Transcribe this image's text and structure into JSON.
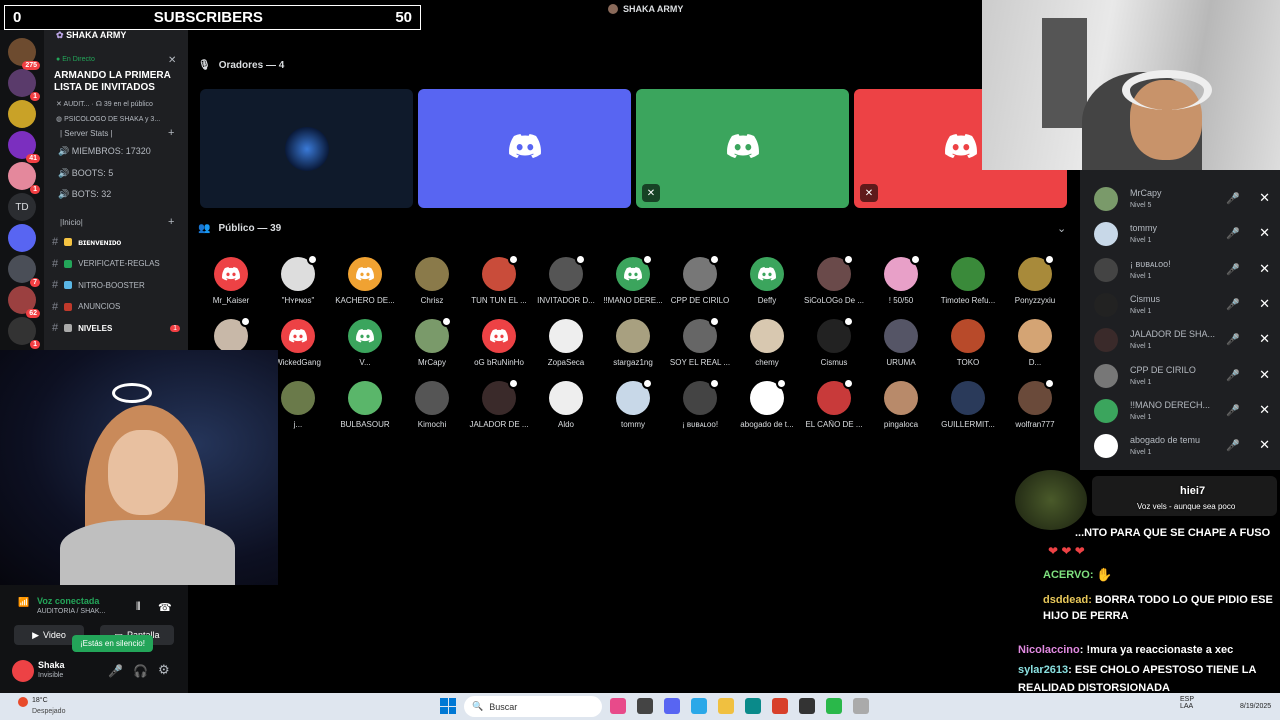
{
  "overlay": {
    "left": "0",
    "label": "SUBSCRIBERS",
    "right": "50"
  },
  "top_user": "SHAKA ARMY",
  "rail": [
    {
      "badge": "275",
      "color": "#6d4b2f"
    },
    {
      "badge": "1",
      "color": "#5a3b6b"
    },
    {
      "badge": "",
      "color": "#c9a227"
    },
    {
      "badge": "41",
      "color": "#7b2fbf"
    },
    {
      "badge": "1",
      "color": "#e4889c"
    },
    {
      "badge": "TD",
      "color": "#2b2d31"
    },
    {
      "badge": "",
      "color": "#5865f2"
    },
    {
      "badge": "7",
      "color": "#4a4e57"
    },
    {
      "badge": "62",
      "color": "#9b4040"
    },
    {
      "badge": "1",
      "color": "#333"
    }
  ],
  "sidebar": {
    "server_name": "SHAKA ARMY",
    "live": "En Directo",
    "event_title": "ARMANDO LA PRIMERA LISTA DE INVITADOS",
    "audit": "AUDIT...",
    "public_count": "39 en el público",
    "psico": "PSICOLOGO DE SHAKA y 3...",
    "stats_header": "| Server Stats |",
    "stats": [
      "MIEMBROS: 17320",
      "BOOTS: 5",
      "BOTS: 32"
    ],
    "inicio_header": "|Inicio|",
    "channels": [
      {
        "label": "ʙɪᴇɴᴠᴇɴɪᴅᴏ",
        "emo": "#f5c342",
        "bold": true
      },
      {
        "label": "VERIFICATE-REGLAS",
        "emo": "#23a559",
        "bold": false
      },
      {
        "label": "NITRO-BOOSTER",
        "emo": "#5ab6e6",
        "bold": false
      },
      {
        "label": "ANUNCIOS",
        "emo": "#c0392b",
        "bold": false
      },
      {
        "label": "NIVELES",
        "emo": "#aaa",
        "bold": true
      }
    ],
    "niveles_badge": "1"
  },
  "user_panel": {
    "voice": "Voz conectada",
    "voice_sub": "AUDITORIA / SHAK...",
    "video": "Video",
    "screen": "Pantalla",
    "tooltip": "¡Estás en silencio!",
    "name": "Shaka",
    "status": "Invisible"
  },
  "stage": {
    "speakers_title": "Oradores — 4",
    "public_title": "Público — 39",
    "speaker_tiles": [
      {
        "color": "#0f1a2b",
        "icon": "avatar"
      },
      {
        "color": "#5865f2",
        "icon": "discord"
      },
      {
        "color": "#3ba55d",
        "icon": "discord"
      },
      {
        "color": "#ed4245",
        "icon": "discord"
      }
    ],
    "audience": [
      [
        {
          "name": "Mr_Kaiser",
          "color": "#ed4245",
          "discord": true,
          "dot": false
        },
        {
          "name": "\"Hʏᴘɴᴏs\"",
          "color": "#ddd",
          "discord": false,
          "dot": true
        },
        {
          "name": "KACHERO DE...",
          "color": "#f0a232",
          "discord": true,
          "dot": false
        },
        {
          "name": "Chrisz",
          "color": "#8a7a4a",
          "discord": false,
          "dot": false
        },
        {
          "name": "TUN TUN EL ...",
          "color": "#c94c3a",
          "discord": false,
          "dot": true
        },
        {
          "name": "INVITADOR D...",
          "color": "#555",
          "discord": false,
          "dot": true
        },
        {
          "name": "!!MANO DERE...",
          "color": "#3ba55d",
          "discord": true,
          "dot": true
        },
        {
          "name": "CPP DE CIRILO",
          "color": "#777",
          "discord": false,
          "dot": true
        },
        {
          "name": "Deffy",
          "color": "#3ba55d",
          "discord": true,
          "dot": false
        },
        {
          "name": "SiCoLOGo De ...",
          "color": "#6a4a4a",
          "discord": false,
          "dot": true
        },
        {
          "name": "! 50/50",
          "color": "#e8a0c8",
          "discord": false,
          "dot": true
        },
        {
          "name": "Timoteo Refu...",
          "color": "#3a8a3a",
          "discord": false,
          "dot": false
        },
        {
          "name": "Ponyzzyxiu",
          "color": "#a88a3a",
          "discord": false,
          "dot": true
        }
      ],
      [
        {
          "name": "",
          "color": "#c8b8a8",
          "discord": false,
          "dot": true
        },
        {
          "name": "WickedGang",
          "color": "#ed4245",
          "discord": true,
          "dot": false
        },
        {
          "name": "V...",
          "color": "#3ba55d",
          "discord": true,
          "dot": false
        },
        {
          "name": "MrCapy",
          "color": "#7a9a6a",
          "discord": false,
          "dot": true
        },
        {
          "name": "oG bRuNinHo",
          "color": "#ed4245",
          "discord": true,
          "dot": false
        },
        {
          "name": "ZopaSeca",
          "color": "#eee",
          "discord": false,
          "dot": false
        },
        {
          "name": "stargaz1ng",
          "color": "#a8a080",
          "discord": false,
          "dot": false
        },
        {
          "name": "SOY EL REAL ...",
          "color": "#666",
          "discord": false,
          "dot": true
        },
        {
          "name": "chemy",
          "color": "#d8c8b0",
          "discord": false,
          "dot": false
        },
        {
          "name": "Cismus",
          "color": "#222",
          "discord": false,
          "dot": true
        },
        {
          "name": "URUMA",
          "color": "#556",
          "discord": false,
          "dot": false
        },
        {
          "name": "TOKO",
          "color": "#b84a2a",
          "discord": false,
          "dot": false
        },
        {
          "name": "D...",
          "color": "#d4a474",
          "discord": false,
          "dot": false
        }
      ],
      [
        {
          "name": "j...",
          "color": "#6a7a4a",
          "discord": false,
          "dot": false
        },
        {
          "name": "BULBASOUR",
          "color": "#5ab66a",
          "discord": false,
          "dot": false
        },
        {
          "name": "Kimochi",
          "color": "#555",
          "discord": false,
          "dot": false
        },
        {
          "name": "JALADOR DE ...",
          "color": "#3a2a2a",
          "discord": false,
          "dot": true
        },
        {
          "name": "Aldo",
          "color": "#eee",
          "discord": false,
          "dot": false
        },
        {
          "name": "tommy",
          "color": "#c8d8e8",
          "discord": false,
          "dot": true
        },
        {
          "name": "¡ ʙᴜʙᴀʟᴏᴏ!",
          "color": "#444",
          "discord": false,
          "dot": true
        },
        {
          "name": "abogado de t...",
          "color": "#fff",
          "discord": false,
          "dot": true
        },
        {
          "name": "EL CAÑO DE ...",
          "color": "#c83a3a",
          "discord": false,
          "dot": true
        },
        {
          "name": "pingaloca",
          "color": "#b88a6a",
          "discord": false,
          "dot": false
        },
        {
          "name": "GUILLERMIT...",
          "color": "#2a3a5a",
          "discord": false,
          "dot": false
        },
        {
          "name": "wolfran777",
          "color": "#6a4a3a",
          "discord": false,
          "dot": true
        }
      ]
    ]
  },
  "right_list": [
    {
      "name": "MrCapy",
      "level": "Nivel 5",
      "color": "#7a9a6a"
    },
    {
      "name": "tommy",
      "level": "Nivel 1",
      "color": "#c8d8e8"
    },
    {
      "name": "¡ ʙᴜʙᴀʟᴏᴏ!",
      "level": "Nivel 1",
      "color": "#444"
    },
    {
      "name": "Cismus",
      "level": "Nivel 1",
      "color": "#222"
    },
    {
      "name": "JALADOR DE SHA...",
      "level": "Nivel 1",
      "color": "#3a2a2a"
    },
    {
      "name": "CPP DE CIRILO",
      "level": "Nivel 1",
      "color": "#777"
    },
    {
      "name": "!!MANO DERECH...",
      "level": "Nivel 1",
      "color": "#3ba55d"
    },
    {
      "name": "abogado de temu",
      "level": "Nivel 1",
      "color": "#fff"
    }
  ],
  "chat": {
    "alert_name": "hiei7",
    "alert_text": "Voz vels - aunque sea poco",
    "lines": [
      {
        "user": "",
        "user_color": "#fff",
        "text": "...NTO PARA QUE SE CHAPE A FUSO"
      },
      {
        "user": "ACERVO:",
        "user_color": "#7fe07f",
        "text": ""
      },
      {
        "user": "dsddead:",
        "user_color": "#e8c85a",
        "text": "BORRA TODO LO QUE PIDIO ESE"
      },
      {
        "user": "",
        "user_color": "#fff",
        "text": "HIJO DE PERRA"
      },
      {
        "user": "Nicolaccino",
        "user_color": "#e08ae0",
        "text": ": !mura ya reaccionaste a xec"
      },
      {
        "user": "sylar2613",
        "user_color": "#8ae0e0",
        "text": ": ESE CHOLO APESTOSO TIENE LA"
      },
      {
        "user": "",
        "user_color": "#fff",
        "text": "REALIDAD DISTORSIONADA"
      }
    ]
  },
  "taskbar": {
    "weather": "18°C",
    "weather_sub": "Despejado",
    "search": "Buscar",
    "lang": "ESP",
    "lang2": "LAA",
    "date": "8/19/2025"
  }
}
